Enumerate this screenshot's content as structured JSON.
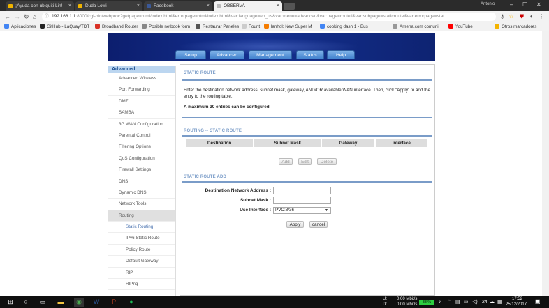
{
  "browser": {
    "tabs": [
      {
        "label": "¡Ayuda con ubiquiti Lin!",
        "color": "#f0b400",
        "active": false
      },
      {
        "label": "Duda Lowi",
        "color": "#f0b400",
        "active": false
      },
      {
        "label": "Facebook",
        "color": "#3b5998",
        "active": false
      },
      {
        "label": "OBSERVA",
        "color": "#bbbbbb",
        "active": true
      }
    ],
    "user": "Antonio",
    "url_host": "192.168.1.1",
    "url_path": ":8000/cgi-bin/webproc?getpage=html/index.html&errorpage=html/index.html&var:language=en_us&var:menu=advanced&var:page=routell&var:subpage=staticroute&var:errorpage=stat...",
    "bookmarks": [
      {
        "label": "Aplicaciones",
        "color": "#4285f4"
      },
      {
        "label": "GitHub - LaQuay/TDT",
        "color": "#222222"
      },
      {
        "label": "Broadband Router",
        "color": "#d93025"
      },
      {
        "label": "Posible netbook form",
        "color": "#888888"
      },
      {
        "label": "Restaurar Paneles",
        "color": "#555555"
      },
      {
        "label": "Fount",
        "color": "#cccccc"
      },
      {
        "label": "lanhol: New Super M",
        "color": "#f57c00"
      },
      {
        "label": "cooking dash 1 - Bus",
        "color": "#4285f4"
      },
      {
        "label": "Amena.com comuni",
        "color": "#999999"
      },
      {
        "label": "YouTube",
        "color": "#ff0000"
      },
      {
        "label": "Otros marcadores",
        "color": "#f4b400"
      }
    ]
  },
  "router": {
    "top_nav": [
      "Setup",
      "Advanced",
      "Management",
      "Status",
      "Help"
    ],
    "sidebar_title": "Advanced",
    "sidebar": [
      {
        "label": "Advanced Wireless",
        "level": 0
      },
      {
        "label": "Port Forwarding",
        "level": 0
      },
      {
        "label": "DMZ",
        "level": 0
      },
      {
        "label": "SAMBA",
        "level": 0
      },
      {
        "label": "3G WAN Configuration",
        "level": 0
      },
      {
        "label": "Parental Control",
        "level": 0
      },
      {
        "label": "Filtering Options",
        "level": 0
      },
      {
        "label": "QoS Configuration",
        "level": 0
      },
      {
        "label": "Firewall Settings",
        "level": 0
      },
      {
        "label": "DNS",
        "level": 0
      },
      {
        "label": "Dynamic DNS",
        "level": 0
      },
      {
        "label": "Network Tools",
        "level": 0
      },
      {
        "label": "Routing",
        "level": 0,
        "selected": true
      },
      {
        "label": "Static Routing",
        "level": 1,
        "link": true
      },
      {
        "label": "IPv6 Static Route",
        "level": 1
      },
      {
        "label": "Policy Route",
        "level": 1
      },
      {
        "label": "Default Gateway",
        "level": 1
      },
      {
        "label": "RIP",
        "level": 1
      },
      {
        "label": "RIPng",
        "level": 1
      }
    ],
    "static_route": {
      "title": "STATIC ROUTE",
      "intro": "Enter the destination network address, subnet mask, gateway, AND/OR available WAN interface. Then, click \"Apply\" to add the entry to the routing table.",
      "max_note": "A maximum 30 entries can be configured."
    },
    "routing_table": {
      "title": "ROUTING -- STATIC ROUTE",
      "columns": [
        "Destination",
        "Subnet Mask",
        "Gateway",
        "Interface"
      ],
      "buttons": {
        "add": "Add",
        "edit": "Edit",
        "delete": "Delete"
      }
    },
    "add_form": {
      "title": "STATIC ROUTE ADD",
      "dest_label": "Destination Network Address :",
      "dest_value": "",
      "mask_label": "Subnet Mask :",
      "mask_value": "",
      "iface_label": "Use Interface :",
      "iface_value": "PVC:8/36",
      "apply": "Apply",
      "cancel": "cancel"
    }
  },
  "taskbar": {
    "net_up_label": "U:",
    "net_down_label": "D:",
    "net_up": "0,00 Mbit/s",
    "net_down": "0,00 Mbit/s",
    "battery": "88 %",
    "temp": "24",
    "time": "17:52",
    "date": "25/12/2017"
  }
}
